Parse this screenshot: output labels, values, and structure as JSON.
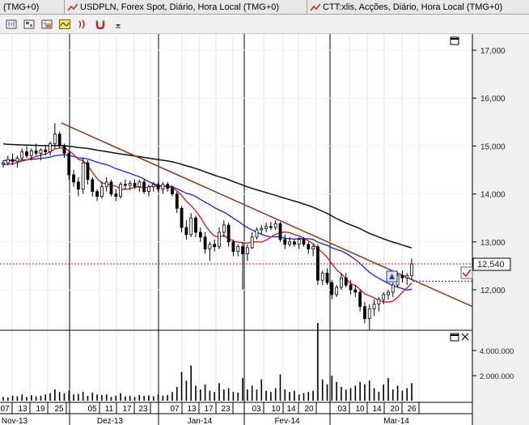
{
  "tabs": [
    {
      "label": "(TMG+0)"
    },
    {
      "label": "USDPLN, Forex Spot, Diário, Hora Local (TMG+0)"
    },
    {
      "label": "CTT:xlis, Acções, Diário, Hora Local (TMG+0)"
    }
  ],
  "toolbar": {
    "buttons": [
      "bar-chart-icon",
      "properties-icon",
      "table-icon",
      "wave-icon",
      "signal-icon",
      "magnet-icon",
      "dropdown-arrow-icon"
    ]
  },
  "price_label": "12,540",
  "colors": {
    "ma_short": "#e01010",
    "ma_mid": "#1a1aff",
    "ma_long": "#111111",
    "trendline": "#8b3a1a",
    "price_line": "#e01010",
    "candle_up": "#ffffff",
    "candle_down": "#000000"
  },
  "chart_data": {
    "type": "candlestick",
    "y_axis": {
      "ticks": [
        "17,000",
        "16,000",
        "15,000",
        "14,000",
        "13,000",
        "12,000"
      ],
      "range": [
        11.1,
        17.4
      ]
    },
    "volume_axis": {
      "ticks": [
        "4.000.000",
        "2.000.000"
      ],
      "range": [
        0,
        6500000
      ]
    },
    "date_ticks": [
      "07",
      "13",
      "19",
      "25",
      "05",
      "11",
      "17",
      "23",
      "07",
      "13",
      "17",
      "23",
      "03",
      "10",
      "14",
      "20",
      "03",
      "10",
      "14",
      "20",
      "26"
    ],
    "month_labels": [
      "Nov-13",
      "Dez-13",
      "Jan-14",
      "Fev-14",
      "Mar-14"
    ],
    "last_price": 12.54,
    "series_names": [],
    "candles": [
      [
        14.62,
        14.7,
        14.55,
        14.65
      ],
      [
        14.65,
        14.8,
        14.6,
        14.72
      ],
      [
        14.72,
        14.85,
        14.6,
        14.68
      ],
      [
        14.68,
        14.8,
        14.55,
        14.75
      ],
      [
        14.75,
        14.95,
        14.7,
        14.88
      ],
      [
        14.88,
        15.0,
        14.75,
        14.8
      ],
      [
        14.8,
        14.95,
        14.7,
        14.9
      ],
      [
        14.9,
        15.05,
        14.8,
        14.85
      ],
      [
        14.85,
        14.95,
        14.7,
        14.92
      ],
      [
        14.92,
        15.0,
        14.8,
        14.88
      ],
      [
        14.88,
        15.1,
        14.8,
        15.05
      ],
      [
        15.05,
        15.48,
        14.95,
        15.25
      ],
      [
        15.25,
        15.3,
        14.95,
        15.0
      ],
      [
        15.0,
        15.05,
        14.75,
        14.85
      ],
      [
        14.85,
        14.9,
        14.3,
        14.4
      ],
      [
        14.4,
        14.5,
        14.15,
        14.25
      ],
      [
        14.25,
        14.35,
        13.95,
        14.1
      ],
      [
        14.1,
        14.75,
        14.0,
        14.65
      ],
      [
        14.65,
        14.7,
        14.2,
        14.3
      ],
      [
        14.3,
        14.35,
        13.95,
        14.05
      ],
      [
        14.05,
        14.1,
        13.85,
        13.95
      ],
      [
        13.95,
        14.25,
        13.9,
        14.15
      ],
      [
        14.15,
        14.35,
        14.05,
        14.25
      ],
      [
        14.25,
        14.3,
        13.95,
        14.0
      ],
      [
        14.0,
        14.1,
        13.85,
        13.95
      ],
      [
        13.95,
        14.25,
        13.9,
        14.2
      ],
      [
        14.2,
        14.3,
        14.1,
        14.18
      ],
      [
        14.18,
        14.28,
        14.08,
        14.22
      ],
      [
        14.22,
        14.3,
        14.1,
        14.15
      ],
      [
        14.15,
        14.3,
        14.05,
        14.25
      ],
      [
        14.25,
        14.3,
        14.0,
        14.05
      ],
      [
        14.05,
        14.2,
        13.95,
        14.15
      ],
      [
        14.15,
        14.25,
        14.05,
        14.2
      ],
      [
        14.2,
        14.25,
        14.05,
        14.1
      ],
      [
        14.1,
        14.25,
        14.0,
        14.2
      ],
      [
        14.2,
        14.25,
        14.05,
        14.12
      ],
      [
        14.12,
        14.18,
        13.95,
        14.0
      ],
      [
        14.0,
        14.05,
        13.6,
        13.7
      ],
      [
        13.7,
        13.75,
        13.2,
        13.3
      ],
      [
        13.3,
        13.45,
        13.05,
        13.15
      ],
      [
        13.15,
        13.6,
        13.1,
        13.5
      ],
      [
        13.5,
        13.55,
        13.1,
        13.2
      ],
      [
        13.2,
        13.3,
        13.0,
        13.1
      ],
      [
        13.1,
        13.2,
        12.75,
        12.85
      ],
      [
        12.85,
        13.0,
        12.6,
        12.95
      ],
      [
        12.95,
        13.05,
        12.8,
        12.9
      ],
      [
        12.9,
        13.3,
        12.85,
        13.2
      ],
      [
        13.2,
        13.45,
        13.1,
        13.35
      ],
      [
        13.35,
        13.4,
        12.9,
        13.0
      ],
      [
        13.0,
        13.05,
        12.7,
        12.8
      ],
      [
        12.8,
        12.95,
        12.7,
        12.9
      ],
      [
        12.9,
        13.0,
        12.0,
        12.75
      ],
      [
        12.75,
        12.95,
        12.6,
        12.88
      ],
      [
        12.88,
        13.2,
        12.85,
        13.1
      ],
      [
        13.1,
        13.3,
        13.05,
        13.25
      ],
      [
        13.25,
        13.35,
        13.15,
        13.28
      ],
      [
        13.28,
        13.4,
        13.2,
        13.32
      ],
      [
        13.32,
        13.42,
        13.25,
        13.3
      ],
      [
        13.3,
        13.45,
        13.25,
        13.38
      ],
      [
        13.38,
        13.42,
        13.0,
        13.05
      ],
      [
        13.05,
        13.15,
        12.85,
        12.95
      ],
      [
        12.95,
        13.1,
        12.9,
        13.0
      ],
      [
        13.0,
        13.05,
        12.9,
        12.95
      ],
      [
        12.95,
        13.1,
        12.85,
        13.05
      ],
      [
        13.05,
        13.1,
        12.9,
        12.95
      ],
      [
        12.95,
        13.0,
        12.75,
        12.85
      ],
      [
        12.85,
        12.95,
        12.7,
        12.9
      ],
      [
        12.9,
        12.95,
        12.1,
        12.2
      ],
      [
        12.2,
        12.4,
        12.1,
        12.35
      ],
      [
        12.35,
        12.45,
        12.1,
        12.15
      ],
      [
        12.15,
        12.2,
        11.8,
        11.9
      ],
      [
        11.9,
        12.1,
        11.85,
        12.05
      ],
      [
        12.05,
        12.35,
        12.0,
        12.25
      ],
      [
        12.25,
        12.35,
        12.05,
        12.1
      ],
      [
        12.1,
        12.2,
        11.9,
        12.0
      ],
      [
        12.0,
        12.1,
        11.85,
        11.95
      ],
      [
        11.95,
        12.0,
        11.55,
        11.65
      ],
      [
        11.65,
        11.75,
        11.3,
        11.4
      ],
      [
        11.4,
        11.7,
        11.15,
        11.6
      ],
      [
        11.6,
        11.8,
        11.45,
        11.7
      ],
      [
        11.7,
        11.85,
        11.55,
        11.8
      ],
      [
        11.8,
        11.95,
        11.7,
        11.9
      ],
      [
        11.9,
        12.0,
        11.8,
        11.95
      ],
      [
        11.95,
        12.15,
        11.85,
        12.1
      ],
      [
        12.1,
        12.35,
        12.05,
        12.3
      ],
      [
        12.3,
        12.4,
        12.15,
        12.25
      ],
      [
        12.25,
        12.35,
        12.1,
        12.3
      ],
      [
        12.3,
        12.65,
        12.2,
        12.54
      ]
    ],
    "volumes": [
      300000,
      250000,
      400000,
      350000,
      500000,
      300000,
      450000,
      350000,
      400000,
      500000,
      600000,
      900000,
      700000,
      600000,
      800000,
      500000,
      550000,
      700000,
      400000,
      650000,
      500000,
      450000,
      500000,
      300000,
      400000,
      600000,
      350000,
      400000,
      300000,
      450000,
      380000,
      420000,
      350000,
      500000,
      400000,
      450000,
      700000,
      1100000,
      2300000,
      1600000,
      2800000,
      1200000,
      900000,
      1300000,
      800000,
      700000,
      1400000,
      900000,
      1000000,
      700000,
      650000,
      1800000,
      900000,
      1200000,
      900000,
      1700000,
      800000,
      700000,
      1000000,
      2100000,
      900000,
      700000,
      800000,
      500000,
      600000,
      700000,
      800000,
      6200000,
      1700000,
      1300000,
      2000000,
      1500000,
      1100000,
      900000,
      1000000,
      1200000,
      1500000,
      1300000,
      1600000,
      1000000,
      700000,
      1300000,
      1800000,
      900000,
      1200000,
      800000,
      1000000,
      1400000
    ]
  }
}
